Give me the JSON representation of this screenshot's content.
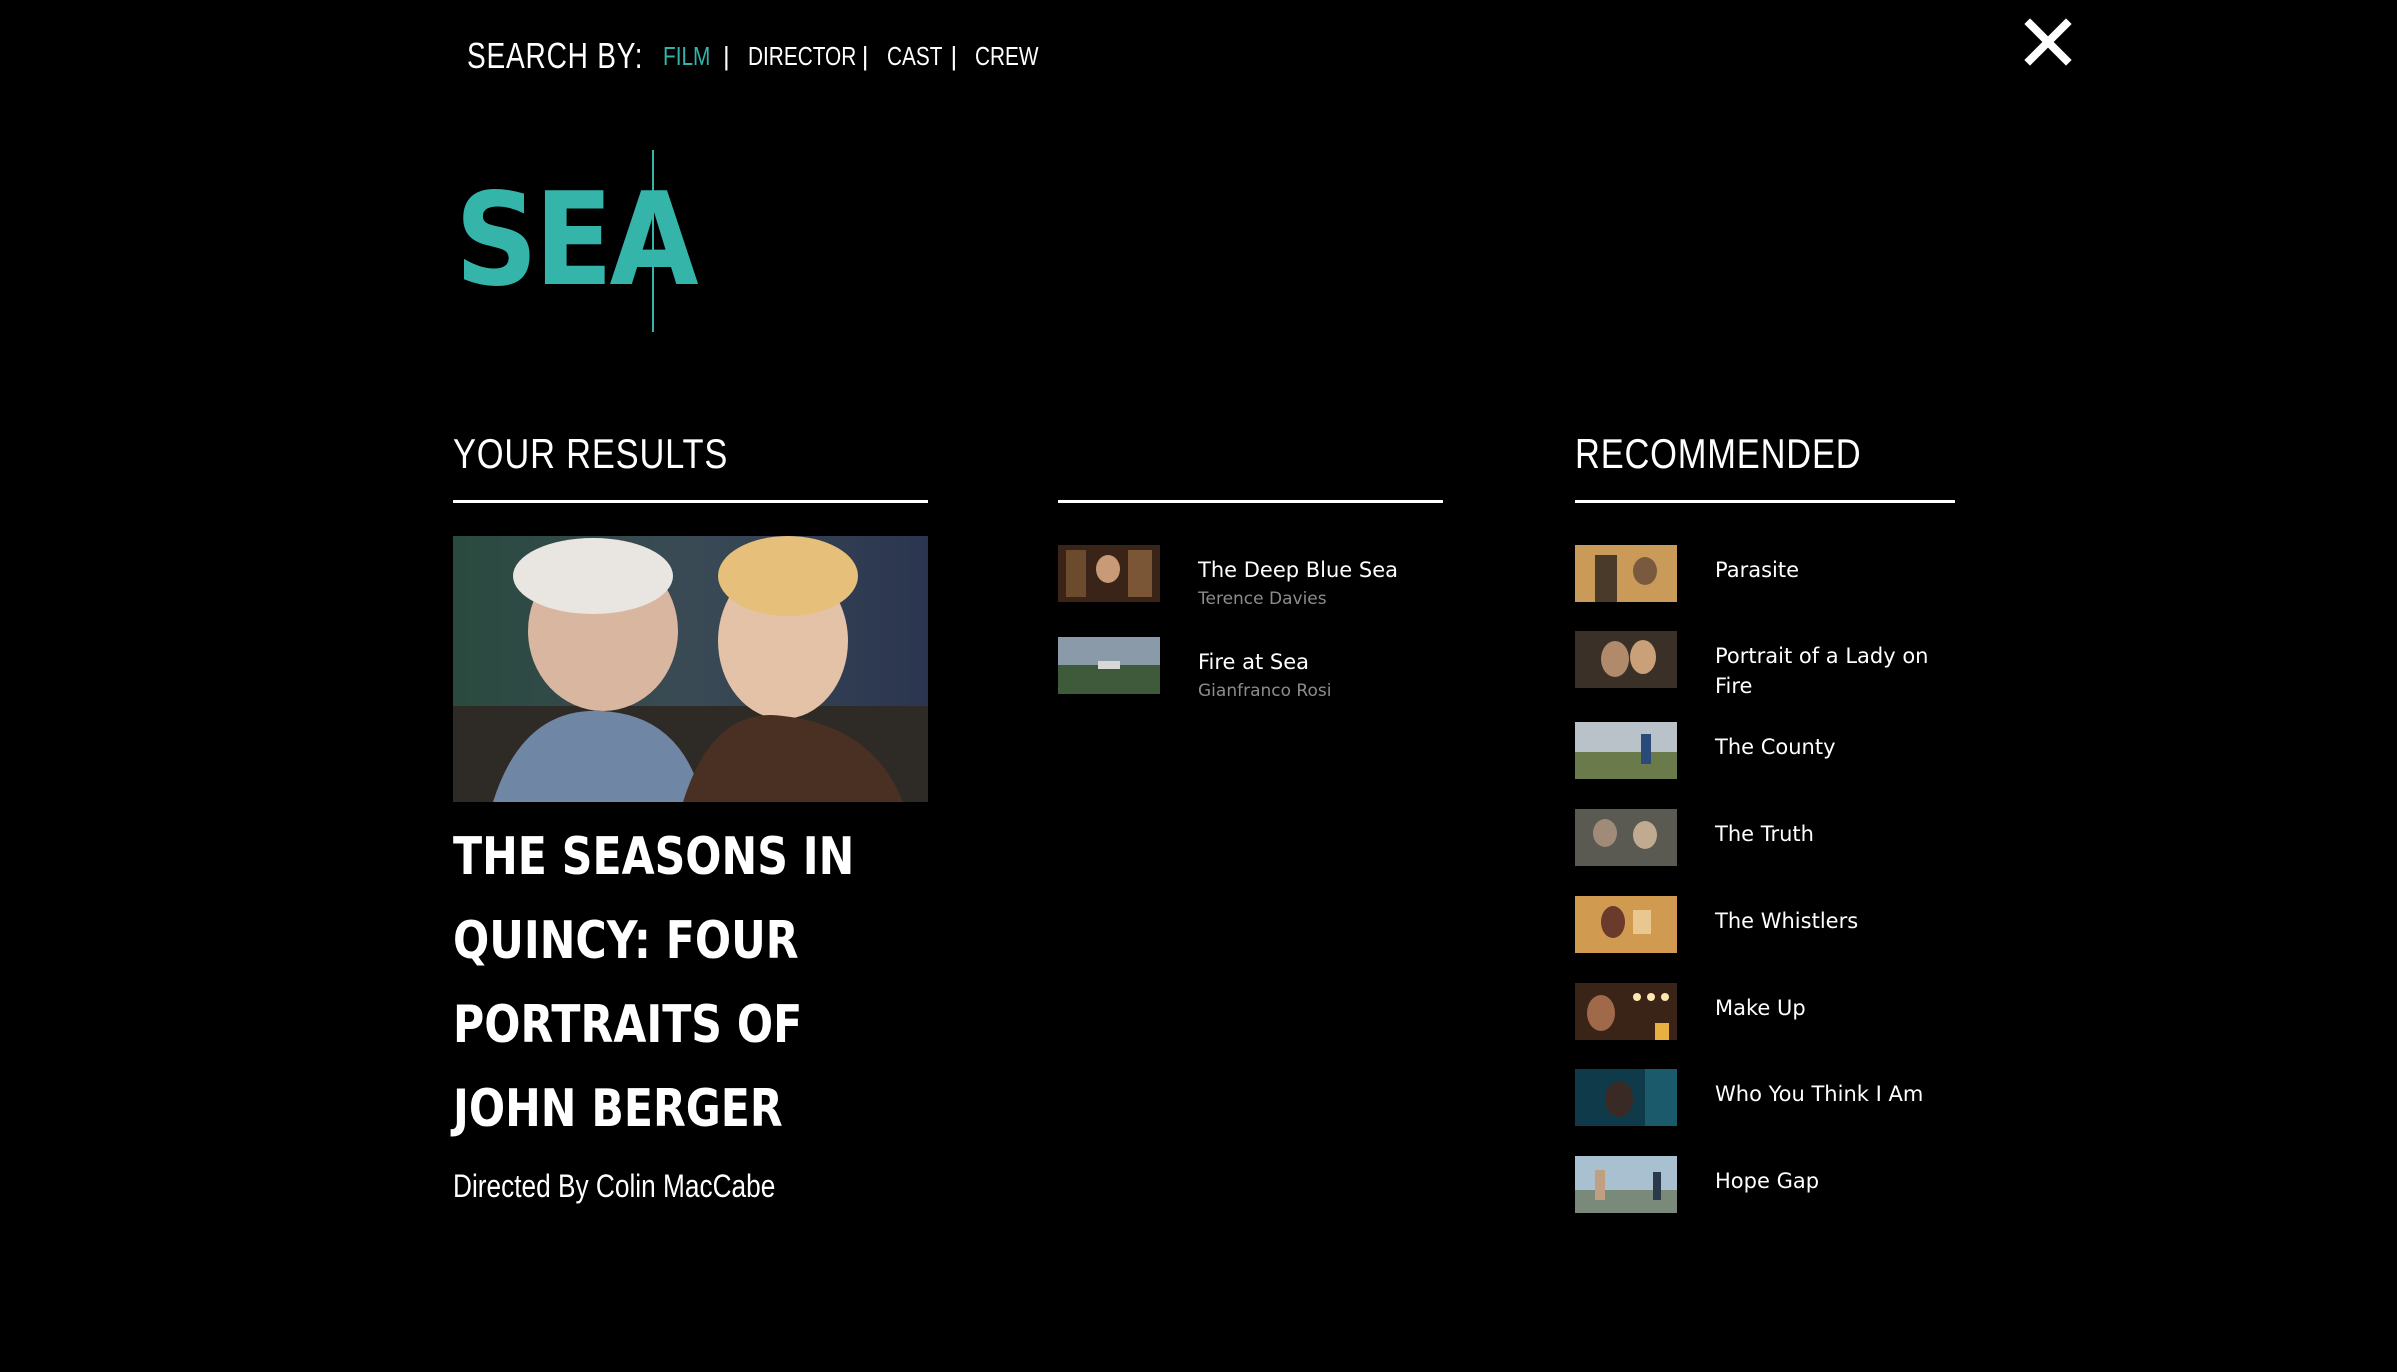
{
  "search_by": {
    "label": "SEARCH BY:",
    "tabs": [
      {
        "label": "FILM",
        "active": true
      },
      {
        "label": "DIRECTOR",
        "active": false
      },
      {
        "label": "CAST",
        "active": false
      },
      {
        "label": "CREW",
        "active": false
      }
    ],
    "separator": "|"
  },
  "close_icon": "close-icon",
  "search": {
    "query": "SEA"
  },
  "results": {
    "heading": "YOUR RESULTS",
    "featured": {
      "title": "THE SEASONS IN QUINCY: FOUR PORTRAITS OF JOHN BERGER",
      "director_line": "Directed By Colin MacCabe"
    },
    "items": [
      {
        "title": "The Deep Blue Sea",
        "director": "Terence Davies"
      },
      {
        "title": "Fire at Sea",
        "director": "Gianfranco Rosi"
      }
    ]
  },
  "recommended": {
    "heading": "RECOMMENDED",
    "items": [
      {
        "title": "Parasite"
      },
      {
        "title": "Portrait of a Lady on Fire"
      },
      {
        "title": "The County"
      },
      {
        "title": "The Truth"
      },
      {
        "title": "The Whistlers"
      },
      {
        "title": "Make Up"
      },
      {
        "title": "Who You Think I Am"
      },
      {
        "title": "Hope Gap"
      }
    ]
  },
  "colors": {
    "accent": "#35b4aa",
    "background": "#000000",
    "text": "#ffffff",
    "muted": "#8c8c8c"
  }
}
